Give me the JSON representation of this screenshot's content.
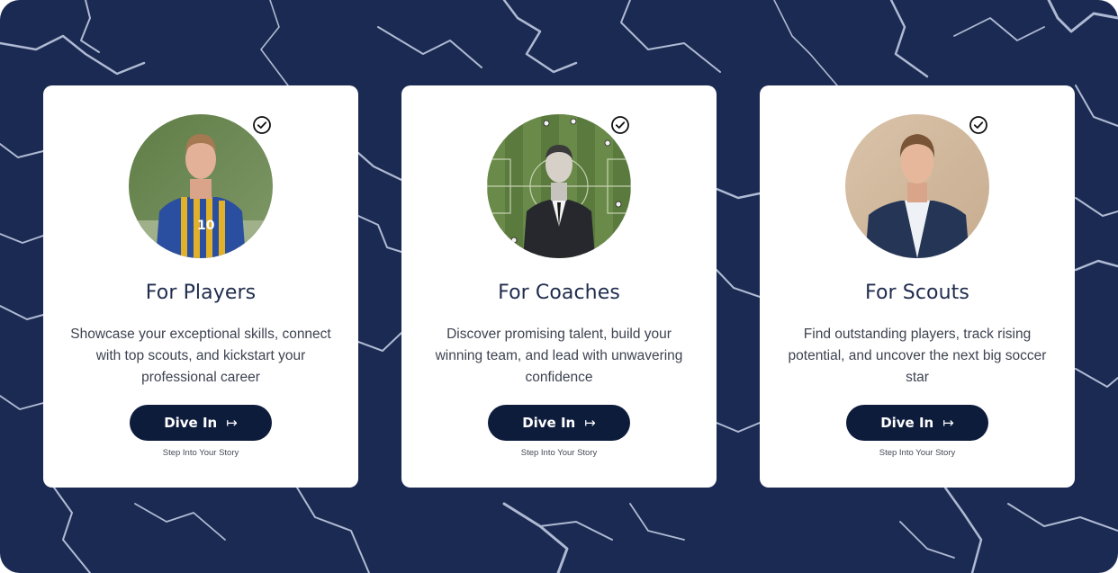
{
  "colors": {
    "background": "#1b2a52",
    "card": "#ffffff",
    "button": "#0e1c3c",
    "title": "#1f2c4d"
  },
  "cards": [
    {
      "title": "For Players",
      "description": "Showcase your exceptional skills, connect with top scouts, and kickstart your professional career",
      "button_label": "Dive In",
      "button_icon": "arrow-right-to-bar-icon",
      "subtext": "Step Into Your Story",
      "badge_icon": "check-circle-icon"
    },
    {
      "title": "For Coaches",
      "description": "Discover promising talent, build your winning team, and lead with unwavering confidence",
      "button_label": "Dive In",
      "button_icon": "arrow-right-to-bar-icon",
      "subtext": "Step Into Your Story",
      "badge_icon": "check-circle-icon"
    },
    {
      "title": "For Scouts",
      "description": "Find outstanding players, track rising potential, and uncover the next big soccer star",
      "button_label": "Dive In",
      "button_icon": "arrow-right-to-bar-icon",
      "subtext": "Step Into Your Story",
      "badge_icon": "check-circle-icon"
    }
  ]
}
